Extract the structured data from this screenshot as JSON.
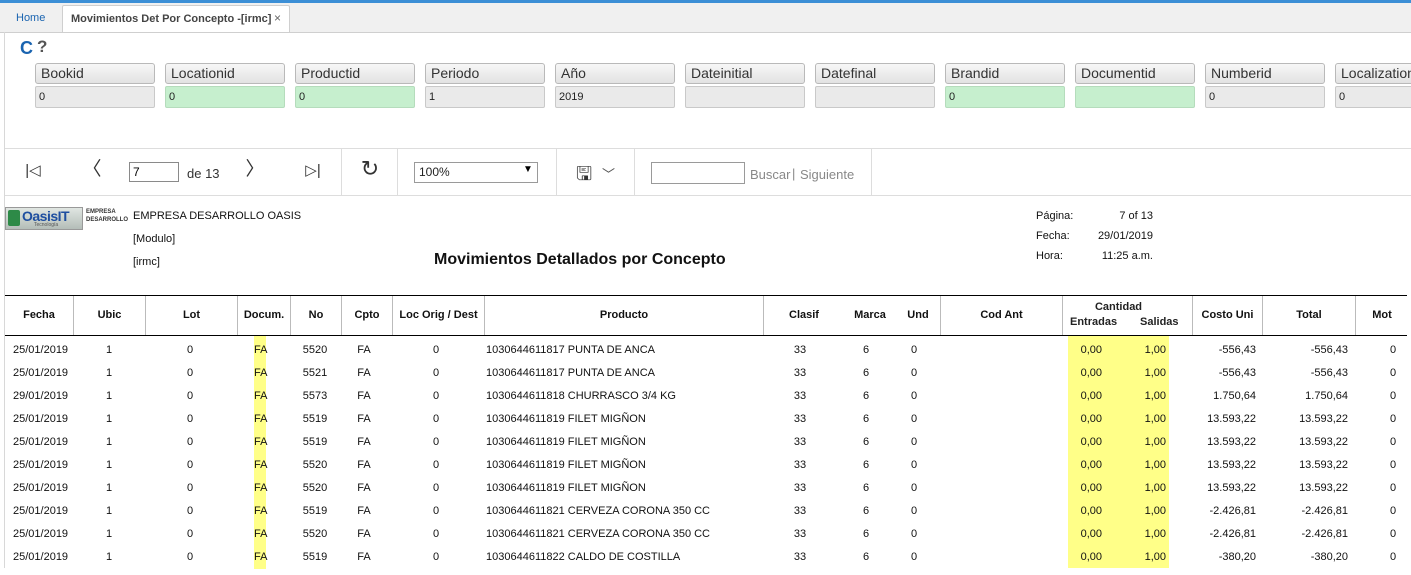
{
  "tabs": {
    "home": "Home",
    "active": "Movimientos Det Por Concepto -[irmc]",
    "close": "×"
  },
  "panel": {
    "refresh_glyph": "C",
    "help_glyph": "?"
  },
  "params": [
    {
      "label": "Bookid",
      "value": "0",
      "highlight": false
    },
    {
      "label": "Locationid",
      "value": "0",
      "highlight": true
    },
    {
      "label": "Productid",
      "value": "0",
      "highlight": true
    },
    {
      "label": "Periodo",
      "value": "1",
      "highlight": false
    },
    {
      "label": "Año",
      "value": "2019",
      "highlight": false
    },
    {
      "label": "Dateinitial",
      "value": "",
      "highlight": false
    },
    {
      "label": "Datefinal",
      "value": "",
      "highlight": false
    },
    {
      "label": "Brandid",
      "value": "0",
      "highlight": true
    },
    {
      "label": "Documentid",
      "value": "",
      "highlight": true
    },
    {
      "label": "Numberid",
      "value": "0",
      "highlight": false
    },
    {
      "label": "Localization",
      "value": "0",
      "highlight": false
    }
  ],
  "toolbar": {
    "first_glyph": "|◁",
    "prev_glyph": "〈",
    "next_glyph": "〉",
    "last_glyph": "▷|",
    "current_page": "7",
    "of_text": "de 13",
    "refresh_glyph": "↻",
    "zoom": "100%",
    "zoom_arrow": "▼",
    "save_glyph": "🖫",
    "save_chevron": "﹀",
    "search_value": "",
    "find_label": "Buscar",
    "find_separator": "|",
    "next_label": "Siguiente"
  },
  "report": {
    "logo_text": "OasisIT",
    "logo_sub": "Tecnología",
    "logo_tag1": "EMPRESA",
    "logo_tag2": "DESARROLLO",
    "company": "EMPRESA DESARROLLO OASIS",
    "modulo": "[Modulo]",
    "code": "[irmc]",
    "title": "Movimientos Detallados por Concepto",
    "pagina_label": "Página:",
    "pagina_value": "7 of 13",
    "fecha_label": "Fecha:",
    "fecha_value": "29/01/2019",
    "hora_label": "Hora:",
    "hora_value": "11:25 a.m."
  },
  "table": {
    "headers": {
      "fecha": "Fecha",
      "ubic": "Ubic",
      "lot": "Lot",
      "docum": "Docum.",
      "no": "No",
      "cpto": "Cpto",
      "loc": "Loc Orig / Dest",
      "producto": "Producto",
      "clasif": "Clasif",
      "marca": "Marca",
      "und": "Und",
      "codant": "Cod Ant",
      "cantidad": "Cantidad",
      "entradas": "Entradas",
      "salidas": "Salidas",
      "costo": "Costo Uni",
      "total": "Total",
      "mot": "Mot"
    },
    "rows": [
      {
        "fecha": "25/01/2019",
        "ubic": "1",
        "lot": "0",
        "docum": "FA",
        "no": "5520",
        "cpto": "FA",
        "loc": "0",
        "producto": "1030644611817  PUNTA DE ANCA",
        "clasif": "33",
        "marca": "6",
        "und": "0",
        "entradas": "0,00",
        "salidas": "1,00",
        "costo": "-556,43",
        "total": "-556,43",
        "mot": "0"
      },
      {
        "fecha": "25/01/2019",
        "ubic": "1",
        "lot": "0",
        "docum": "FA",
        "no": "5521",
        "cpto": "FA",
        "loc": "0",
        "producto": "1030644611817  PUNTA DE ANCA",
        "clasif": "33",
        "marca": "6",
        "und": "0",
        "entradas": "0,00",
        "salidas": "1,00",
        "costo": "-556,43",
        "total": "-556,43",
        "mot": "0"
      },
      {
        "fecha": "29/01/2019",
        "ubic": "1",
        "lot": "0",
        "docum": "FA",
        "no": "5573",
        "cpto": "FA",
        "loc": "0",
        "producto": "1030644611818  CHURRASCO 3/4 KG",
        "clasif": "33",
        "marca": "6",
        "und": "0",
        "entradas": "0,00",
        "salidas": "1,00",
        "costo": "1.750,64",
        "total": "1.750,64",
        "mot": "0"
      },
      {
        "fecha": "25/01/2019",
        "ubic": "1",
        "lot": "0",
        "docum": "FA",
        "no": "5519",
        "cpto": "FA",
        "loc": "0",
        "producto": "1030644611819  FILET MIGÑON",
        "clasif": "33",
        "marca": "6",
        "und": "0",
        "entradas": "0,00",
        "salidas": "1,00",
        "costo": "13.593,22",
        "total": "13.593,22",
        "mot": "0"
      },
      {
        "fecha": "25/01/2019",
        "ubic": "1",
        "lot": "0",
        "docum": "FA",
        "no": "5519",
        "cpto": "FA",
        "loc": "0",
        "producto": "1030644611819  FILET MIGÑON",
        "clasif": "33",
        "marca": "6",
        "und": "0",
        "entradas": "0,00",
        "salidas": "1,00",
        "costo": "13.593,22",
        "total": "13.593,22",
        "mot": "0"
      },
      {
        "fecha": "25/01/2019",
        "ubic": "1",
        "lot": "0",
        "docum": "FA",
        "no": "5520",
        "cpto": "FA",
        "loc": "0",
        "producto": "1030644611819  FILET MIGÑON",
        "clasif": "33",
        "marca": "6",
        "und": "0",
        "entradas": "0,00",
        "salidas": "1,00",
        "costo": "13.593,22",
        "total": "13.593,22",
        "mot": "0"
      },
      {
        "fecha": "25/01/2019",
        "ubic": "1",
        "lot": "0",
        "docum": "FA",
        "no": "5520",
        "cpto": "FA",
        "loc": "0",
        "producto": "1030644611819  FILET MIGÑON",
        "clasif": "33",
        "marca": "6",
        "und": "0",
        "entradas": "0,00",
        "salidas": "1,00",
        "costo": "13.593,22",
        "total": "13.593,22",
        "mot": "0"
      },
      {
        "fecha": "25/01/2019",
        "ubic": "1",
        "lot": "0",
        "docum": "FA",
        "no": "5519",
        "cpto": "FA",
        "loc": "0",
        "producto": "1030644611821  CERVEZA CORONA 350 CC",
        "clasif": "33",
        "marca": "6",
        "und": "0",
        "entradas": "0,00",
        "salidas": "1,00",
        "costo": "-2.426,81",
        "total": "-2.426,81",
        "mot": "0"
      },
      {
        "fecha": "25/01/2019",
        "ubic": "1",
        "lot": "0",
        "docum": "FA",
        "no": "5520",
        "cpto": "FA",
        "loc": "0",
        "producto": "1030644611821  CERVEZA CORONA 350 CC",
        "clasif": "33",
        "marca": "6",
        "und": "0",
        "entradas": "0,00",
        "salidas": "1,00",
        "costo": "-2.426,81",
        "total": "-2.426,81",
        "mot": "0"
      },
      {
        "fecha": "25/01/2019",
        "ubic": "1",
        "lot": "0",
        "docum": "FA",
        "no": "5519",
        "cpto": "FA",
        "loc": "0",
        "producto": "1030644611822  CALDO DE COSTILLA",
        "clasif": "33",
        "marca": "6",
        "und": "0",
        "entradas": "0,00",
        "salidas": "1,00",
        "costo": "-380,20",
        "total": "-380,20",
        "mot": "0"
      }
    ]
  }
}
